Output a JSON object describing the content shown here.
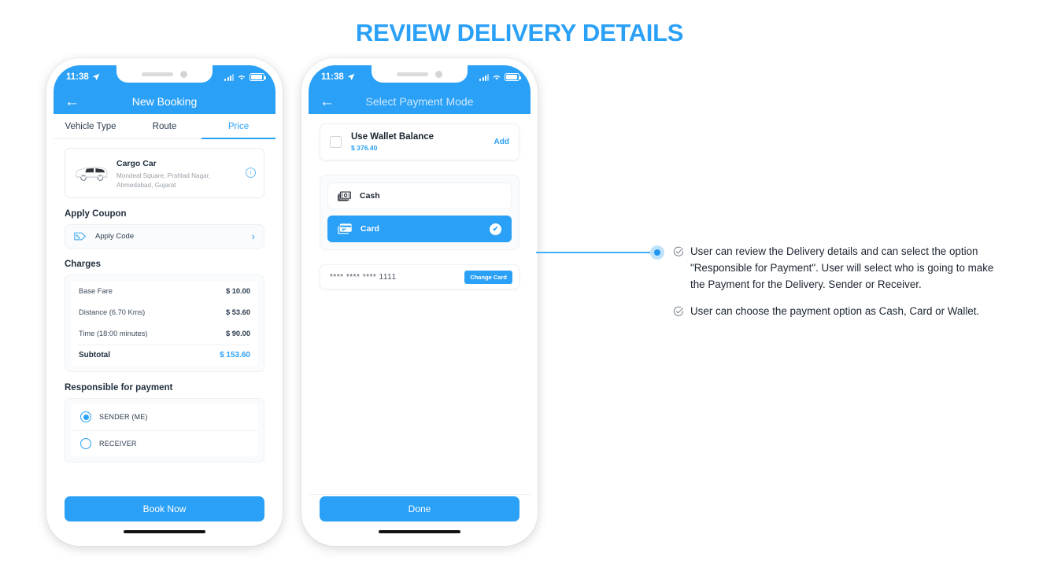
{
  "title": "REVIEW DELIVERY DETAILS",
  "colors": {
    "accent": "#2AA0F7",
    "line": "#3FAEF6",
    "dot": "#2196F3"
  },
  "phone1": {
    "status": {
      "time": "11:38",
      "location_icon": "location-arrow-icon",
      "signal_icon": "signal-bars-icon",
      "wifi_icon": "wifi-icon",
      "battery_icon": "battery-icon"
    },
    "nav": {
      "back_icon": "back-arrow-icon",
      "title": "New Booking"
    },
    "tabs": [
      {
        "label": "Vehicle Type",
        "active": false
      },
      {
        "label": "Route",
        "active": false
      },
      {
        "label": "Price",
        "active": true
      }
    ],
    "vehicle": {
      "icon": "cargo-van-icon",
      "name": "Cargo Car",
      "address_line1": "Mondeal Square, Prahlad Nagar,",
      "address_line2": "Ahmedabad, Gujarat",
      "info_icon": "info-circle-icon"
    },
    "coupon": {
      "heading": "Apply Coupon",
      "icon": "coupon-tag-icon",
      "label": "Apply Code",
      "chevron": "chevron-right-icon"
    },
    "charges": {
      "heading": "Charges",
      "rows": [
        {
          "label": "Base Fare",
          "amount": "$ 10.00"
        },
        {
          "label": "Distance (6.70 Kms)",
          "amount": "$ 53.60"
        },
        {
          "label": "Time (18:00 minutes)",
          "amount": "$ 90.00"
        }
      ],
      "total": {
        "label": "Subtotal",
        "amount": "$ 153.60"
      }
    },
    "responsible": {
      "heading": "Responsible for payment",
      "options": [
        {
          "label": "SENDER (ME)",
          "selected": true
        },
        {
          "label": "RECEIVER",
          "selected": false
        }
      ]
    },
    "cta": "Book Now"
  },
  "phone2": {
    "status": {
      "time": "11:38",
      "location_icon": "location-arrow-icon",
      "signal_icon": "signal-bars-icon",
      "wifi_icon": "wifi-icon",
      "battery_icon": "battery-icon"
    },
    "nav": {
      "back_icon": "back-arrow-icon",
      "title": "Select Payment Mode"
    },
    "wallet": {
      "checkbox": "checkbox-unchecked-icon",
      "label": "Use Wallet Balance",
      "amount": "$ 376.40",
      "action": "Add"
    },
    "payment_options": [
      {
        "icon": "cash-icon",
        "label": "Cash",
        "selected": false
      },
      {
        "icon": "credit-card-icon",
        "label": "Card",
        "selected": true,
        "check_icon": "check-circle-icon"
      }
    ],
    "card": {
      "number": "**** **** **** 1111",
      "button": "Change Card"
    },
    "cta": "Done"
  },
  "annotation": {
    "bullet_icon": "check-circle-outline-icon",
    "notes": [
      "User can review the Delivery details and can select the option \"Responsible for Payment\". User will select who is going to make the Payment for the Delivery. Sender or Receiver.",
      "User can choose the payment option as Cash, Card or Wallet."
    ]
  }
}
